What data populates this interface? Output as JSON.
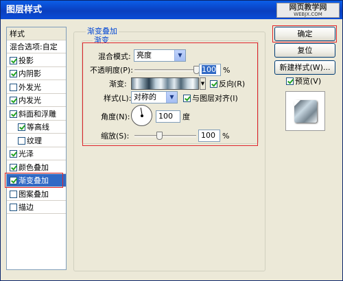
{
  "window": {
    "title": "图层样式"
  },
  "watermark": {
    "big": "网页教学网",
    "small": "WEBJX.COM"
  },
  "stylelist": {
    "header": "样式",
    "items": [
      {
        "label": "混合选项:自定",
        "checkbox": false,
        "checked": false
      },
      {
        "label": "投影",
        "checkbox": true,
        "checked": true
      },
      {
        "label": "内阴影",
        "checkbox": true,
        "checked": true
      },
      {
        "label": "外发光",
        "checkbox": true,
        "checked": false
      },
      {
        "label": "内发光",
        "checkbox": true,
        "checked": true
      },
      {
        "label": "斜面和浮雕",
        "checkbox": true,
        "checked": true
      },
      {
        "label": "等高线",
        "checkbox": true,
        "checked": true,
        "sub": true
      },
      {
        "label": "纹理",
        "checkbox": true,
        "checked": false,
        "sub": true
      },
      {
        "label": "光泽",
        "checkbox": true,
        "checked": true
      },
      {
        "label": "颜色叠加",
        "checkbox": true,
        "checked": true
      },
      {
        "label": "渐变叠加",
        "checkbox": true,
        "checked": true,
        "selected": true
      },
      {
        "label": "图案叠加",
        "checkbox": true,
        "checked": false
      },
      {
        "label": "描边",
        "checkbox": true,
        "checked": false
      }
    ]
  },
  "panel": {
    "group_title": "渐变叠加",
    "inner_title": "渐变",
    "blend_mode_label": "混合模式:",
    "blend_mode_value": "亮度",
    "opacity_label": "不透明度(P):",
    "opacity_value": "100",
    "opacity_unit": "%",
    "opacity_fraction": 1.0,
    "gradient_label": "渐变:",
    "reverse_label": "反向(R)",
    "reverse_checked": true,
    "style_label": "样式(L):",
    "style_value": "对称的",
    "align_label": "与图层对齐(I)",
    "align_checked": true,
    "angle_label": "角度(N):",
    "angle_value": "100",
    "angle_unit": "度",
    "scale_label": "缩放(S):",
    "scale_value": "100",
    "scale_unit": "%",
    "scale_fraction": 0.4
  },
  "buttons": {
    "ok": "确定",
    "reset": "复位",
    "new_style": "新建样式(W)...",
    "preview_label": "预览(V)",
    "preview_checked": true
  },
  "colors": {
    "highlight": "#e0242b",
    "selection": "#316ac5",
    "accent_title": "#0046d5"
  }
}
